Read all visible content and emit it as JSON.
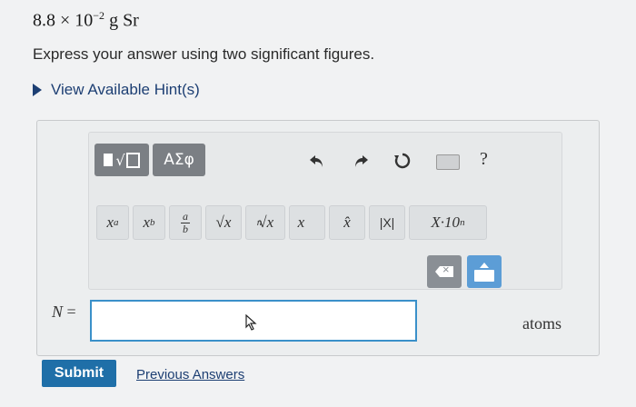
{
  "question": {
    "coefficient": "8.8 × 10",
    "exponent": "−2",
    "unit": "g Sr"
  },
  "instructions": "Express your answer using two significant figures.",
  "hint_link": "View Available Hint(s)",
  "toolbar": {
    "greek_label": "ΑΣφ",
    "help_label": "?",
    "keys": {
      "power_base": "x",
      "power_exp": "a",
      "sub_base": "x",
      "sub_idx": "b",
      "frac_num": "a",
      "frac_den": "b",
      "sqrt": "√x",
      "nroot_index": "n",
      "nroot": "√x",
      "vector": "x⃗",
      "unit_vector": "x̂",
      "abs": "|X|",
      "sci_main": "X·10",
      "sci_exp": "n"
    }
  },
  "answer": {
    "variable": "N",
    "equals": "=",
    "value": "",
    "units": "atoms"
  },
  "actions": {
    "submit": "Submit",
    "previous": "Previous Answers"
  },
  "colors": {
    "accent": "#1f6fa8",
    "link": "#1d3f73",
    "input_border": "#3a90c9"
  }
}
